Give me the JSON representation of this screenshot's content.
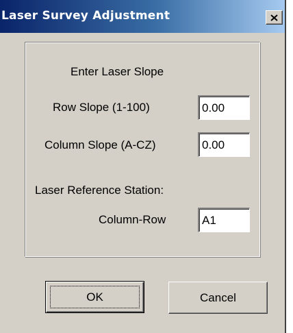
{
  "window": {
    "title": "Laser Survey Adjustment",
    "close_label": "×"
  },
  "slope": {
    "heading": "Enter Laser  Slope",
    "row_label": "Row  Slope (1-100)",
    "row_value": "0.00",
    "column_label": "Column Slope (A-CZ)",
    "column_value": "0.00"
  },
  "reference": {
    "heading": "Laser Reference Station:",
    "column_row_label": "Column-Row",
    "column_row_value": "A1"
  },
  "buttons": {
    "ok_label": "OK",
    "cancel_label": "Cancel"
  }
}
